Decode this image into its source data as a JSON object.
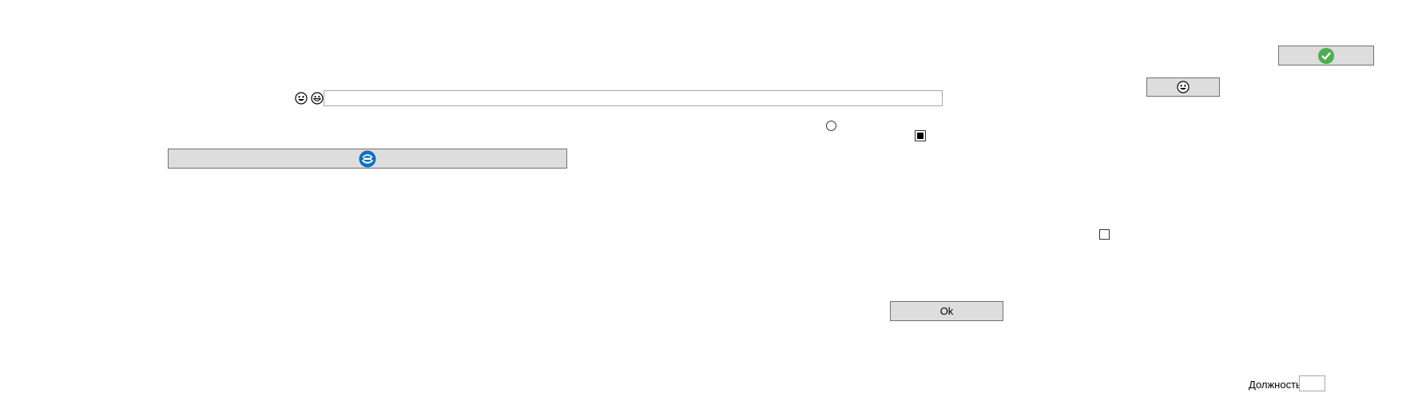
{
  "buttons": {
    "ok_label": "Ok"
  },
  "fields": {
    "text_value": "",
    "small_value": ""
  },
  "labels": {
    "position": "Должность"
  },
  "icons": {
    "check": "check-circle-icon",
    "smile": "smiley-face-icon",
    "grin": "grinning-face-icon",
    "sync": "sync-circle-icon"
  },
  "states": {
    "radio_checked": false,
    "square_checkbox_checked": true,
    "empty_checkbox_checked": false
  },
  "colors": {
    "button_bg": "#dddddd",
    "check_green": "#4caf50",
    "sync_blue": "#0f6fbf"
  }
}
